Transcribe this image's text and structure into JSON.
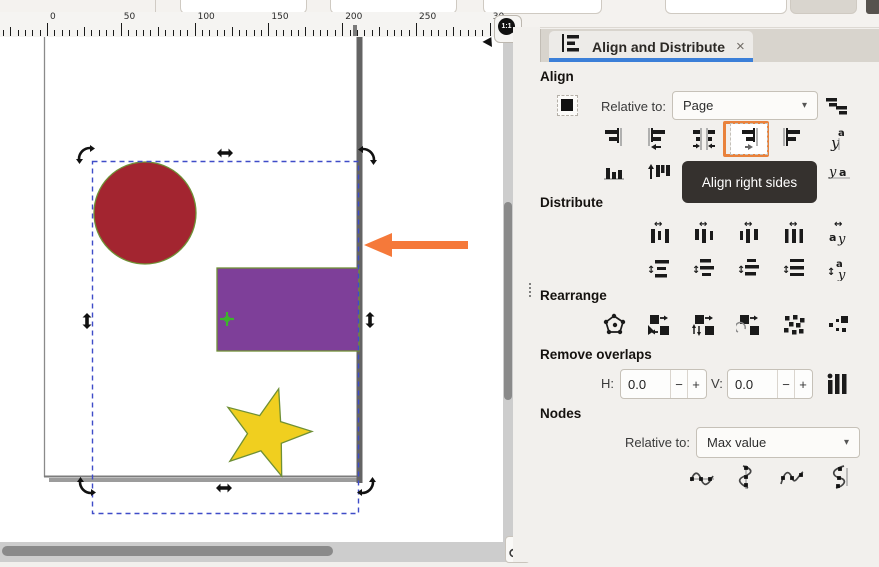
{
  "ruler": {
    "labels": [
      "0",
      "50",
      "100",
      "150",
      "200",
      "250",
      "30"
    ]
  },
  "zoom_indicator": {
    "label": "1:1"
  },
  "glyphs": {
    "caret": "▾"
  },
  "canvas": {
    "shapes": [
      "red-circle",
      "purple-rectangle",
      "yellow-star"
    ],
    "annotation": "left-pointing-arrow",
    "selection_mode": "rotate-skew-handles"
  },
  "panel": {
    "tab": {
      "title": "Align and Distribute",
      "close_label": "×"
    },
    "align": {
      "header": "Align",
      "relative_to_label": "Relative to:",
      "relative_to_value": "Page",
      "row1": [
        "align-right-to-anchor",
        "align-left-edges",
        "center-on-vertical-axis",
        "align-right-sides",
        "align-left-to-anchor",
        "text-anchor-horizontal"
      ],
      "row2": [
        "align-bottoms",
        "align-tops",
        "center-on-horizontal-axis",
        "align-bottoms-to-anchor-top",
        "align-tops-to-anchor-bottom",
        "align-text-baselines"
      ],
      "highlighted_button": "align-right-sides",
      "tooltip": "Align right sides"
    },
    "distribute": {
      "header": "Distribute",
      "row1": [
        "distribute-left-edges",
        "distribute-centers-horizontally",
        "distribute-right-edges",
        "distribute-equal-horizontal-gaps",
        "distribute-text-anchors-horizontal"
      ],
      "row2": [
        "distribute-top-edges",
        "distribute-centers-vertically",
        "distribute-bottom-edges",
        "distribute-equal-vertical-gaps",
        "distribute-text-anchors-vertical"
      ]
    },
    "rearrange": {
      "header": "Rearrange",
      "row": [
        "make-edges-network",
        "exchange-selection-order",
        "exchange-stacking-order",
        "exchange-clockwise",
        "randomize-positions",
        "unclump"
      ]
    },
    "remove_overlaps": {
      "header": "Remove overlaps",
      "h_label": "H:",
      "h_value": "0.0",
      "v_label": "V:",
      "v_value": "0.0",
      "minus_label": "−",
      "plus_label": "+"
    },
    "nodes": {
      "header": "Nodes",
      "relative_to_label": "Relative to:",
      "relative_to_value": "Max value",
      "row": [
        "align-nodes-horizontally",
        "align-nodes-vertically",
        "distribute-nodes-horizontally",
        "distribute-nodes-vertically"
      ]
    }
  },
  "colors": {
    "accent_blue": "#3b7fd8",
    "highlight_orange": "#e9823c",
    "tooltip_bg": "#35312e",
    "circle_fill": "#a32530",
    "rect_fill": "#7e3f99",
    "star_fill": "#f0cf1f",
    "shape_stroke": "#6f9035",
    "annotation_arrow": "#f5793a",
    "selection_dash": "#3f4cc8",
    "page_border": "#646464"
  }
}
